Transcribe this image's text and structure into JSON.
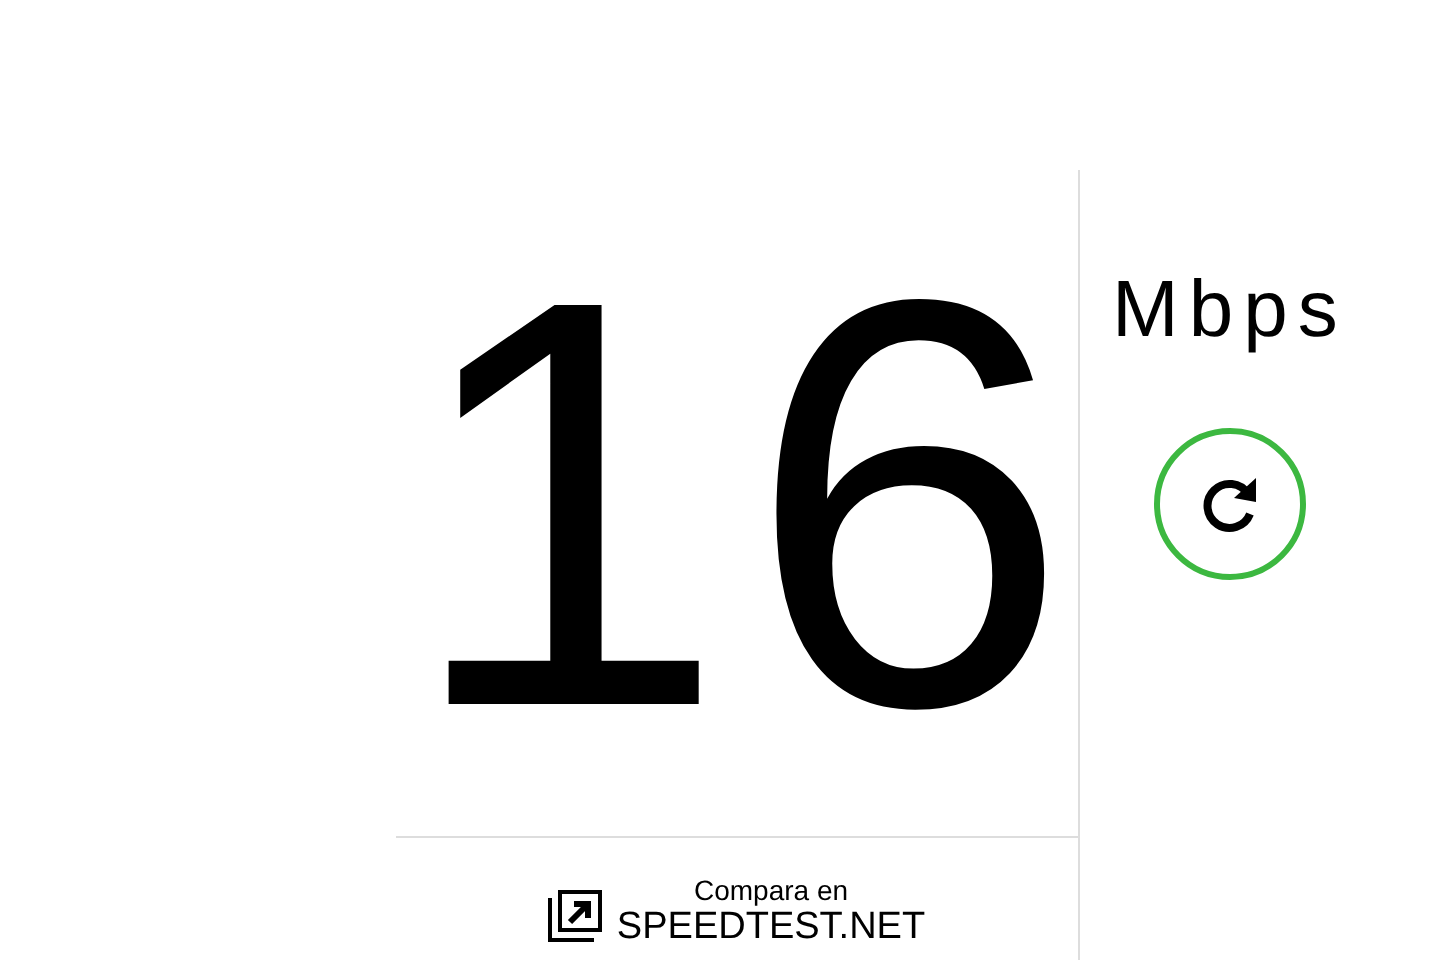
{
  "speed": {
    "value": "16",
    "unit": "Mbps"
  },
  "compare": {
    "caption": "Compara en",
    "link": "SPEEDTEST.NET"
  }
}
